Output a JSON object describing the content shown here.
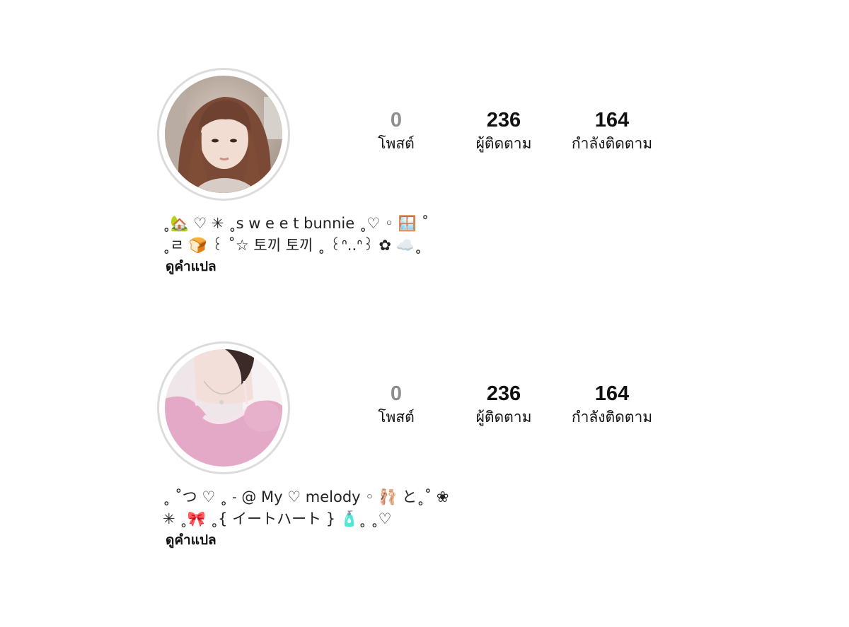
{
  "profiles": [
    {
      "stats": {
        "posts": {
          "value": "0",
          "label": "โพสต์"
        },
        "followers": {
          "value": "236",
          "label": "ผู้ติดตาม"
        },
        "following": {
          "value": "164",
          "label": "กำลังติดตาม"
        }
      },
      "bio": {
        "line1": "˳🏡 ♡ ✳ ˳s w e e t bunnie ˳♡ ◦ 🪟 ˚",
        "line2": "˳ㄹ 🍞 ꒰ ˚☆ 토끼 토끼 ˳ ꒰ᐢ..ᐢ꒱ ✿ ☁️˳",
        "translate_label": "ดูคำแปล"
      },
      "avatar_desc_colors": {
        "bg": "#cdbfb4",
        "hair": "#7a4a36",
        "skin": "#f2ddd2"
      }
    },
    {
      "stats": {
        "posts": {
          "value": "0",
          "label": "โพสต์"
        },
        "followers": {
          "value": "236",
          "label": "ผู้ติดตาม"
        },
        "following": {
          "value": "164",
          "label": "กำลังติดตาม"
        }
      },
      "bio": {
        "line1": "˳ ˚つ ♡ ˳ ˗ @ My ♡ melody ◦ 🩰 と˳˚ ❀",
        "line2": "✳ ˳🎀 ˳{ イートハート } 🧴˳ ˳♡",
        "translate_label": "ดูคำแปล"
      },
      "avatar_desc_colors": {
        "bg": "#efe6ea",
        "top": "#e4a9c6",
        "skin": "#f3dfd9"
      }
    }
  ]
}
